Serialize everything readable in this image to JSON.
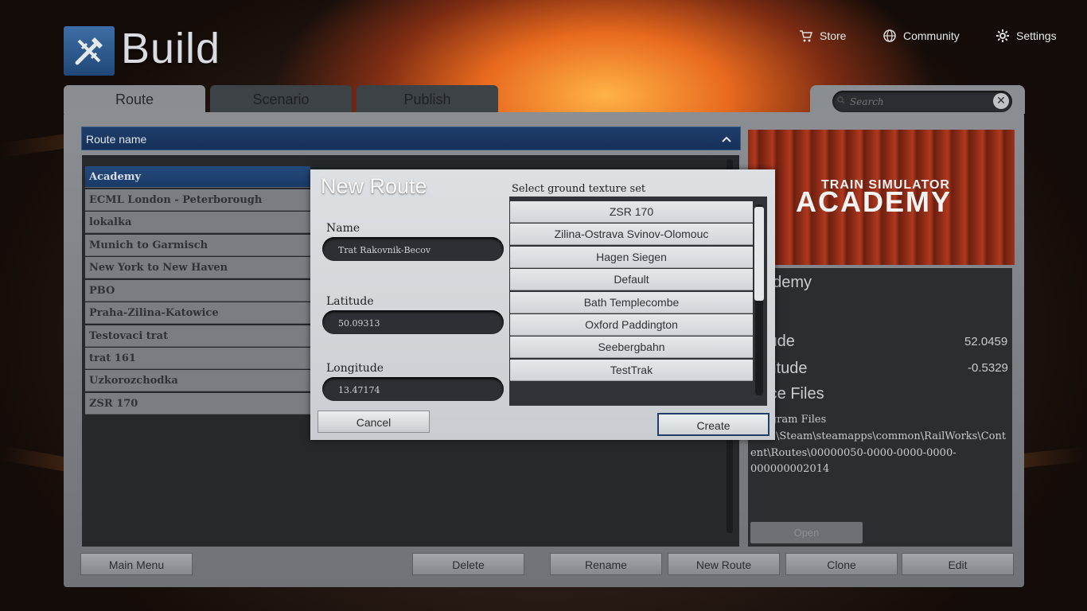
{
  "header": {
    "title": "Build"
  },
  "topnav": {
    "store": "Store",
    "community": "Community",
    "settings": "Settings"
  },
  "tabs": [
    {
      "label": "Route"
    },
    {
      "label": "Scenario"
    },
    {
      "label": "Publish"
    }
  ],
  "search": {
    "placeholder": "Search"
  },
  "route_list": {
    "header": "Route name",
    "items": [
      "Academy",
      "ECML London - Peterborough",
      "lokalka",
      "Munich to Garmisch",
      "New York to New Haven",
      "PBO",
      "Praha-Zilina-Katowice",
      "Testovaci trat",
      "trat 161",
      "Uzkorozchodka",
      "ZSR 170"
    ]
  },
  "info": {
    "logo_small": "TRAIN SIMULATOR",
    "logo_big": "ACADEMY",
    "name": "ademy",
    "lat_label": "tude",
    "lat_value": "52.0459",
    "lon_label": "gitude",
    "lon_value": "-0.5329",
    "source_label": "rce Files",
    "path_line1": "ogram Files",
    "path_line2": "\\Steam\\steamapps\\common\\RailWorks\\Cont",
    "path_line3": "ent\\Routes\\00000050-0000-0000-0000-",
    "path_line4": "000000002014",
    "open_button": "Open"
  },
  "bottom_buttons": {
    "main_menu": "Main Menu",
    "delete": "Delete",
    "rename": "Rename",
    "new_route": "New Route",
    "clone": "Clone",
    "edit": "Edit"
  },
  "modal": {
    "title": "New Route",
    "name_label": "Name",
    "name_value": "Trat Rakovnik-Becov",
    "lat_label": "Latitude",
    "lat_value": "50.09313",
    "lon_label": "Longitude",
    "lon_value": "13.47174",
    "texture_label": "Select ground texture set",
    "textures": [
      "ZSR 170",
      "Zilina-Ostrava Svinov-Olomouc",
      "Hagen Siegen",
      "Default",
      "Bath Templecombe",
      "Oxford Paddington",
      "Seebergbahn",
      "TestTrak"
    ],
    "cancel": "Cancel",
    "create": "Create"
  }
}
